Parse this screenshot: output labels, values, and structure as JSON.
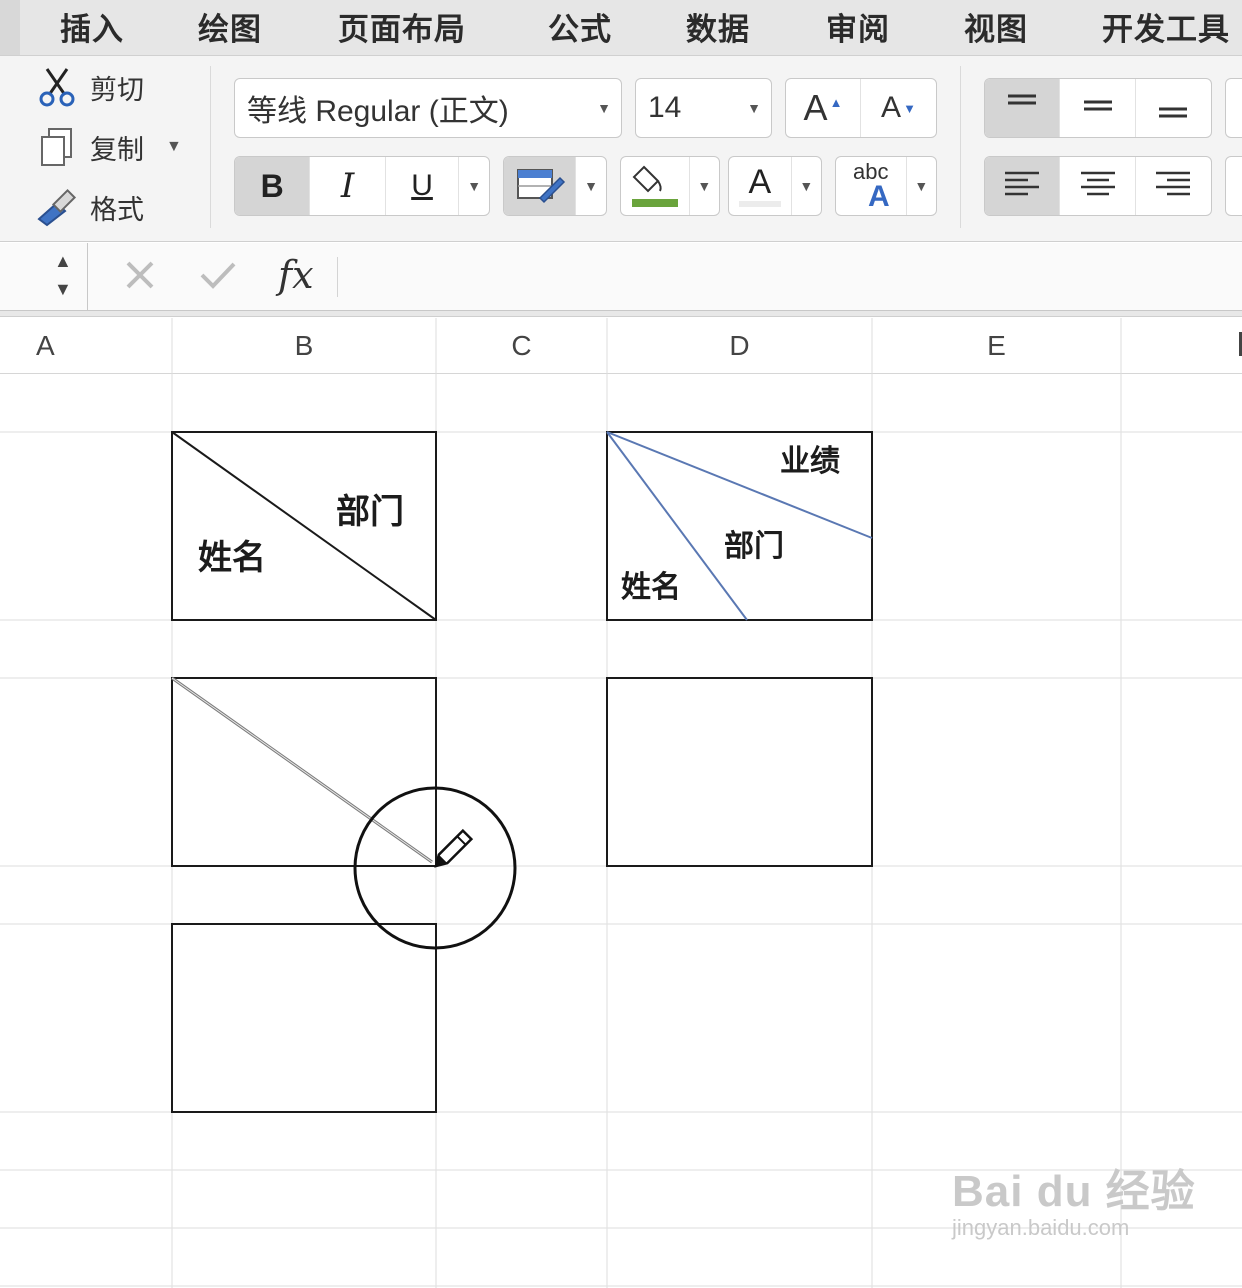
{
  "menu_tabs": [
    "插入",
    "绘图",
    "页面布局",
    "公式",
    "数据",
    "审阅",
    "视图",
    "开发工具"
  ],
  "clipboard": {
    "cut_label": "剪切",
    "copy_label": "复制",
    "format_label": "格式"
  },
  "font": {
    "name": "等线 Regular (正文)",
    "size": "14",
    "bold": "B",
    "italic": "I",
    "underline": "U",
    "font_color_glyph": "A",
    "grow_glyph": "A",
    "shrink_glyph": "A",
    "phonetic_top": "abc",
    "phonetic_bottom": "A"
  },
  "colors": {
    "fill_color": "#6aa43c",
    "diagonal_blue": "#5a78b3",
    "border": "#1a1a1a",
    "ribbon_bg": "#f4f4f4",
    "tab_bg": "#e6e6e6"
  },
  "formula_bar": {
    "fx_label": "fx",
    "content": ""
  },
  "columns": [
    "A",
    "B",
    "C",
    "D",
    "E"
  ],
  "cells": {
    "b_header": {
      "top_right": "部门",
      "bottom_left": "姓名"
    },
    "d_header": {
      "top": "业绩",
      "middle": "部门",
      "bottom": "姓名"
    }
  },
  "watermark": {
    "logo": "Bai du 经验",
    "url": "jingyan.baidu.com"
  }
}
